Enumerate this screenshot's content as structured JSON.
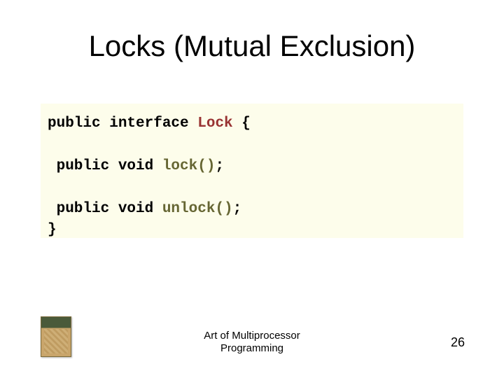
{
  "title": "Locks (Mutual Exclusion)",
  "code": {
    "l1a": "public interface ",
    "l1b": "Lock",
    "l1c": " {",
    "l2a": " public void ",
    "l2b": "lock()",
    "l2c": ";",
    "l3a": " public void ",
    "l3b": "unlock()",
    "l3c": ";",
    "l4": "}"
  },
  "footer": {
    "line1": "Art of Multiprocessor",
    "line2": "Programming"
  },
  "slide_number": "26"
}
